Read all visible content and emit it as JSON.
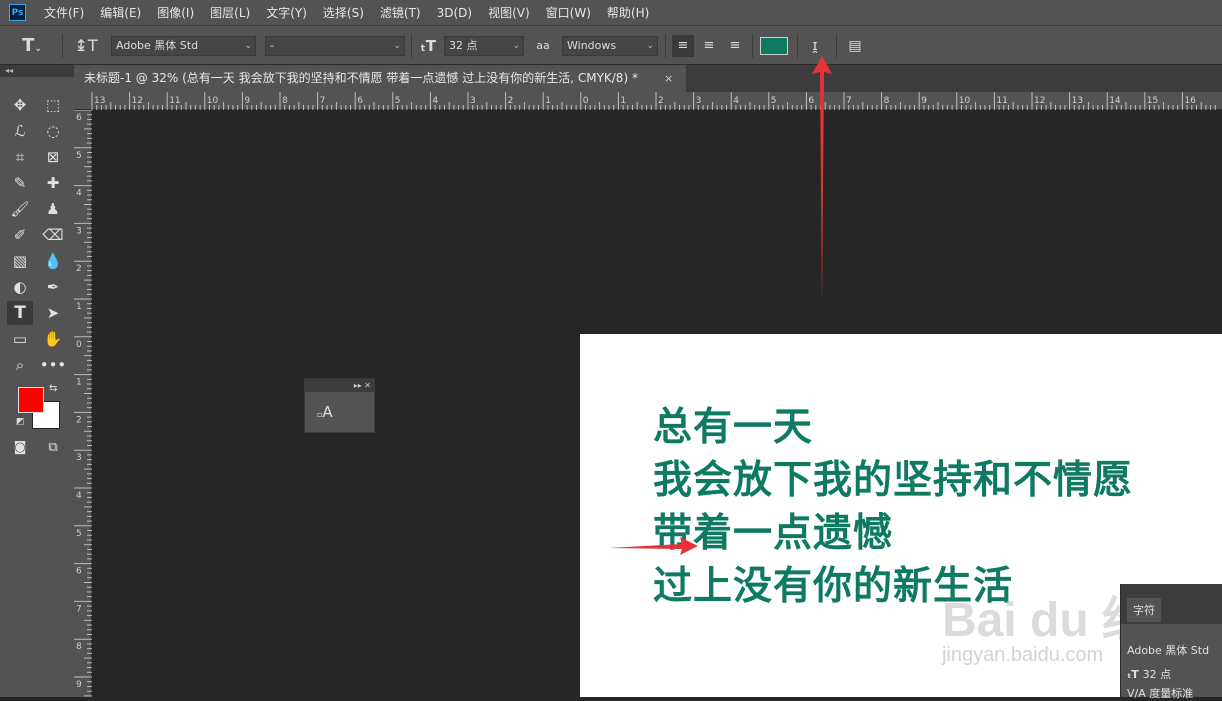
{
  "app": {
    "logo": "Ps"
  },
  "menu": [
    "文件(F)",
    "编辑(E)",
    "图像(I)",
    "图层(L)",
    "文字(Y)",
    "选择(S)",
    "滤镜(T)",
    "3D(D)",
    "视图(V)",
    "窗口(W)",
    "帮助(H)"
  ],
  "options": {
    "font_family": "Adobe 黑体 Std",
    "font_style": "-",
    "font_size": "32 点",
    "antialias_label": "aa",
    "antialias": "Windows",
    "text_color": "#0f7a62"
  },
  "tab": {
    "title": "未标题-1 @ 32% (总有一天 我会放下我的坚持和不情愿 带着一点遗憾 过上没有你的新生活, CMYK/8) *",
    "close": "×"
  },
  "ruler": {
    "top": [
      "13",
      "12",
      "11",
      "10",
      "9",
      "8",
      "7",
      "6",
      "5",
      "4",
      "3",
      "2",
      "1",
      "0",
      "1",
      "2",
      "3",
      "4",
      "5",
      "6",
      "7",
      "8",
      "9",
      "10",
      "11",
      "12",
      "13",
      "14",
      "15",
      "16"
    ],
    "left": [
      "6",
      "5",
      "4",
      "3",
      "2",
      "1",
      "0",
      "1",
      "2",
      "3",
      "4",
      "5",
      "6",
      "7",
      "8",
      "9"
    ]
  },
  "colors": {
    "foreground": "#ff0000",
    "background": "#ffffff",
    "text": "#0f7a62",
    "arrow": "#e8323a"
  },
  "document_text": [
    "总有一天",
    "我会放下我的坚持和不情愿",
    "带着一点遗憾",
    "过上没有你的新生活"
  ],
  "watermark": {
    "logo": "Bai du 经验",
    "url": "jingyan.baidu.com"
  },
  "char_panel": {
    "tab": "字符",
    "font": "Adobe 黑体 Std",
    "size": "32 点",
    "tracking": "度量标准"
  },
  "icons": {
    "type_tool": "T",
    "glyph_panel": "A"
  }
}
